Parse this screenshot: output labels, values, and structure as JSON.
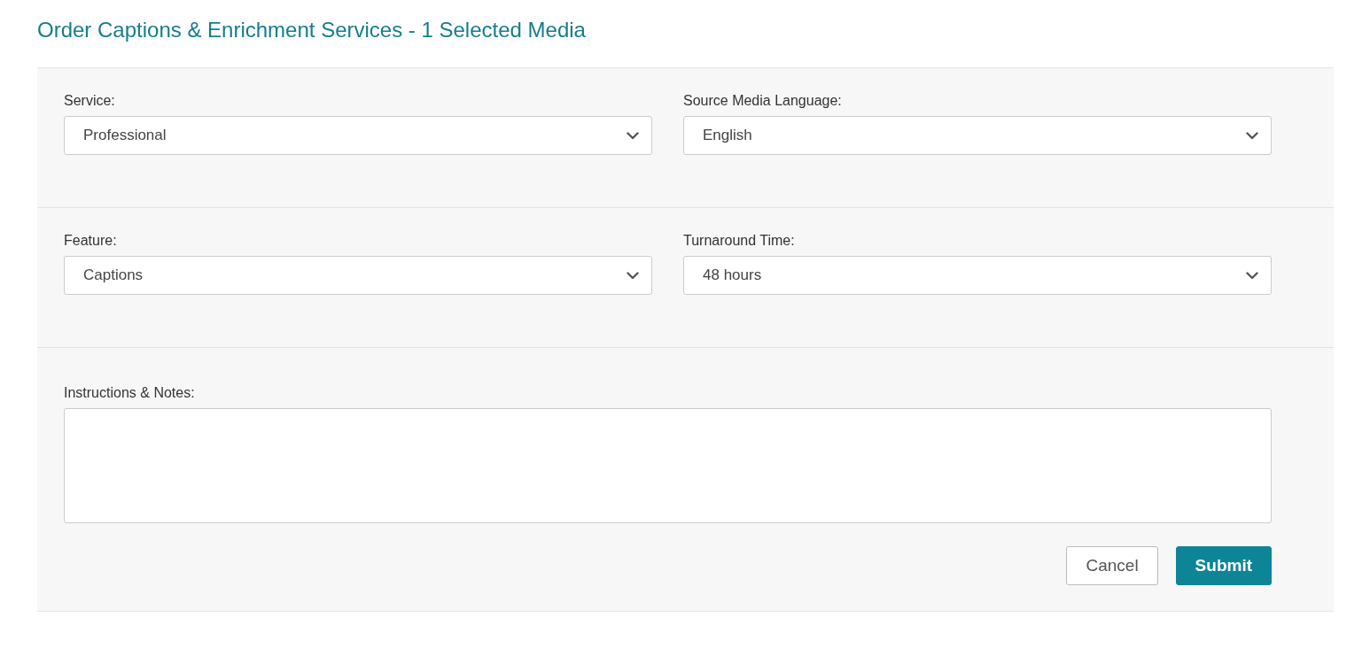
{
  "title": "Order Captions & Enrichment Services - 1 Selected Media",
  "sections": [
    {
      "fields": [
        {
          "label": "Service:",
          "value": "Professional"
        },
        {
          "label": "Source Media Language:",
          "value": "English"
        }
      ]
    },
    {
      "fields": [
        {
          "label": "Feature:",
          "value": "Captions"
        },
        {
          "label": "Turnaround Time:",
          "value": "48 hours"
        }
      ]
    }
  ],
  "notes": {
    "label": "Instructions & Notes:"
  },
  "buttons": [
    {
      "label": "Cancel",
      "kind": "secondary"
    },
    {
      "label": "Submit",
      "kind": "primary"
    }
  ]
}
